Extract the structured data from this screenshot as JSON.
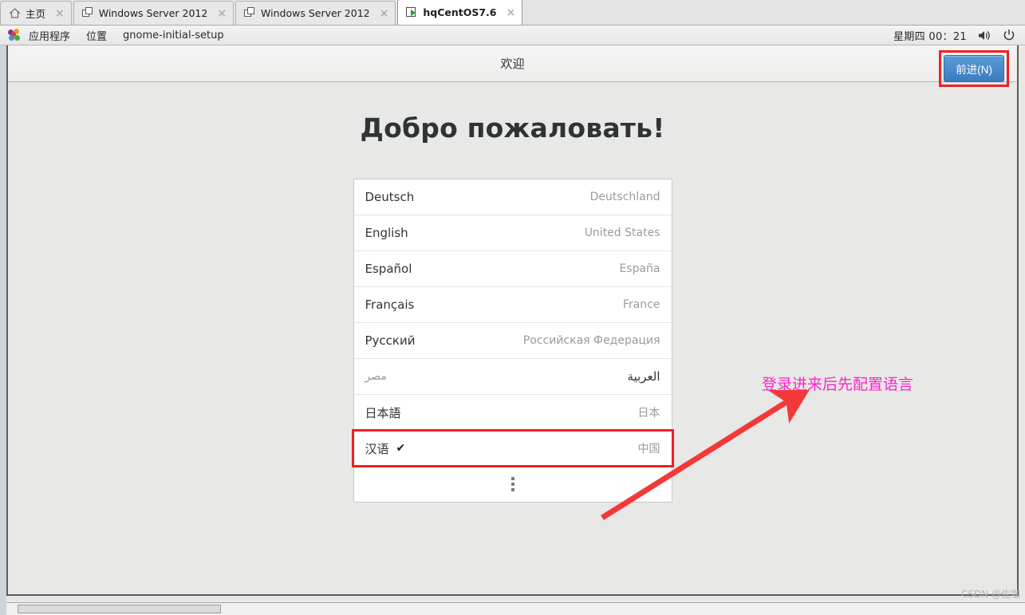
{
  "vmware": {
    "tabs": [
      {
        "label": "主页",
        "icon": "home-icon",
        "active": false,
        "close": "×"
      },
      {
        "label": "Windows Server 2012",
        "icon": "window-icon",
        "active": false,
        "close": "×"
      },
      {
        "label": "Windows Server 2012",
        "icon": "window-icon",
        "active": false,
        "close": "×"
      },
      {
        "label": "hqCentOS7.6",
        "icon": "vm-running-icon",
        "active": true,
        "close": "×"
      }
    ]
  },
  "gnome_panel": {
    "applications_label": "应用程序",
    "places_label": "位置",
    "window_label": "gnome-initial-setup",
    "clock": "星期四 00：21",
    "volume_icon": "volume-icon",
    "power_icon": "power-icon",
    "apps_icon": "centos-apps-icon"
  },
  "window": {
    "title": "欢迎",
    "next_button": "前进(N)",
    "heading": "Добро пожаловать!"
  },
  "language_list": {
    "rows": [
      {
        "name": "Deutsch",
        "country": "Deutschland",
        "selected": false,
        "rtl": false,
        "check": ""
      },
      {
        "name": "English",
        "country": "United States",
        "selected": false,
        "rtl": false,
        "check": ""
      },
      {
        "name": "Español",
        "country": "España",
        "selected": false,
        "rtl": false,
        "check": ""
      },
      {
        "name": "Français",
        "country": "France",
        "selected": false,
        "rtl": false,
        "check": ""
      },
      {
        "name": "Русский",
        "country": "Российская Федерация",
        "selected": false,
        "rtl": false,
        "check": ""
      },
      {
        "name": "العربية",
        "country": "مصر",
        "selected": false,
        "rtl": true,
        "check": ""
      },
      {
        "name": "日本語",
        "country": "日本",
        "selected": false,
        "rtl": false,
        "check": ""
      },
      {
        "name": "汉语",
        "country": "中国",
        "selected": true,
        "rtl": false,
        "check": "✔"
      }
    ],
    "more_icon": "more-vertical-icon"
  },
  "annotation": {
    "text": "登录进来后先配置语言",
    "text_color": "#ff22cc",
    "arrow_color": "#f43838",
    "highlight_color": "#f02020"
  },
  "watermark": {
    "text": "CSDN @佐咖"
  }
}
